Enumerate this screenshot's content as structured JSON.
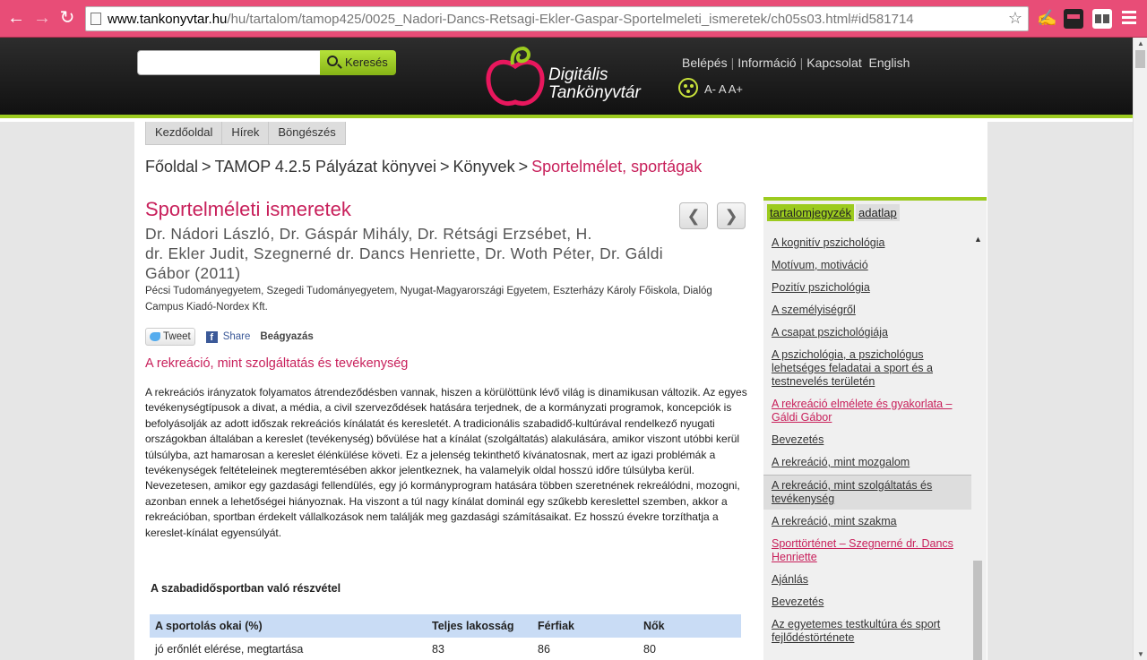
{
  "browser": {
    "url_host": "www.tankonyvtar.hu",
    "url_path": "/hu/tartalom/tamop425/0025_Nadori-Dancs-Retsagi-Ekler-Gaspar-Sportelmeleti_ismeretek/ch05s03.html#id581714",
    "back_icon": "arrow-left",
    "forward_icon": "arrow-right",
    "reload_icon": "reload",
    "star_icon": "star",
    "theme_color": "#e84d77"
  },
  "header": {
    "search_placeholder": "",
    "search_button": "Keresés",
    "logo_line1": "Digitális",
    "logo_line2": "Tankönyvtár",
    "links": [
      "Belépés",
      "Információ",
      "Kapcsolat",
      "English"
    ],
    "font_controls": "A- A A+",
    "accent_color": "#9ccb1f"
  },
  "tabs": [
    "Kezdőoldal",
    "Hírek",
    "Böngészés"
  ],
  "breadcrumb": {
    "items": [
      "Főoldal",
      "TAMOP 4.2.5 Pályázat könyvei",
      "Könyvek"
    ],
    "current": "Sportelmélet, sportágak",
    "separator": ">"
  },
  "book": {
    "title": "Sportelméleti ismeretek",
    "authors_line1": "Dr. Nádori László, Dr. Gáspár Mihály, Dr. Rétsági Erzsébet, H.",
    "authors_line2": "dr. Ekler Judit, Szegnerné dr. Dancs Henriette, Dr. Woth Péter, Dr. Gáldi",
    "authors_line3": "Gábor (2011)",
    "publisher": "Pécsi Tudományegyetem, Szegedi Tudományegyetem, Nyugat-Magyarországi Egyetem, Eszterházy Károly Főiskola, Dialóg Campus Kiadó-Nordex Kft."
  },
  "social": {
    "tweet": "Tweet",
    "share": "Share",
    "embed": "Beágyazás"
  },
  "section": {
    "title": "A rekreáció, mint szolgáltatás és tevékenység",
    "body": "A rekreációs irányzatok folyamatos átrendeződésben vannak, hiszen a körülöttünk lévő világ is dinamikusan változik. Az egyes tevékenységtípusok a divat, a média, a civil szerveződések hatására terjednek, de a kormányzati programok, koncepciók is befolyásolják az adott időszak rekreációs kínálatát és keresletét. A tradicionális szabadidő-kultúrával rendelkező nyugati országokban általában a kereslet (tevékenység) bővülése hat a kínálat (szolgáltatás) alakulására, amikor viszont utóbbi kerül túlsúlyba, azt hamarosan a kereslet élénkülése követi. Ez a jelenség tekinthető kívánatosnak, mert az igazi problémák a tevékenységek feltételeinek megteremtésében akkor jelentkeznek, ha valamelyik oldal hosszú időre túlsúlyba kerül. Nevezetesen, amikor egy gazdasági fellendülés, egy jó kormányprogram hatására többen szeretnének rekreálódni, mozogni, azonban ennek a lehetőségei hiányoznak. Ha viszont a túl nagy kínálat dominál egy szűkebb kereslettel szemben, akkor a rekreációban, sportban érdekelt vállalkozások nem találják meg gazdasági számításaikat. Ez hosszú évekre torzíthatja a kereslet-kínálat egyensúlyát."
  },
  "table": {
    "caption": "A szabadidősportban való részvétel",
    "headers": [
      "A sportolás okai (%)",
      "Teljes lakosság",
      "Férfiak",
      "Nők"
    ],
    "rows": [
      [
        "jó erőnlét elérése, megtartása",
        "83",
        "86",
        "80"
      ]
    ],
    "header_color": "#c9dcf5"
  },
  "sidebar": {
    "tab_active": "tartalomjegyzék",
    "tab_inactive": "adatlap",
    "items": [
      {
        "label": "A kognitív pszichológia",
        "style": "normal"
      },
      {
        "label": "Motívum, motiváció",
        "style": "normal"
      },
      {
        "label": "Pozitív pszichológia",
        "style": "normal"
      },
      {
        "label": "A személyiségről",
        "style": "normal"
      },
      {
        "label": "A csapat pszichológiája",
        "style": "normal"
      },
      {
        "label": "A pszichológia, a pszichológus lehetséges feladatai a sport és a testnevelés területén",
        "style": "normal"
      },
      {
        "label": "A rekreáció elmélete és gyakorlata – Gáldi Gábor",
        "style": "pink"
      },
      {
        "label": "Bevezetés",
        "style": "normal"
      },
      {
        "label": "A rekreáció, mint mozgalom",
        "style": "normal"
      },
      {
        "label": "A rekreáció, mint szolgáltatás és tevékenység",
        "style": "selected"
      },
      {
        "label": "A rekreáció, mint szakma",
        "style": "normal"
      },
      {
        "label": "Sporttörténet – Szegnerné dr. Dancs Henriette",
        "style": "pink"
      },
      {
        "label": "Ajánlás",
        "style": "normal"
      },
      {
        "label": "Bevezetés",
        "style": "normal"
      },
      {
        "label": "Az egyetemes testkultúra és sport fejlődéstörténete",
        "style": "normal"
      }
    ]
  }
}
